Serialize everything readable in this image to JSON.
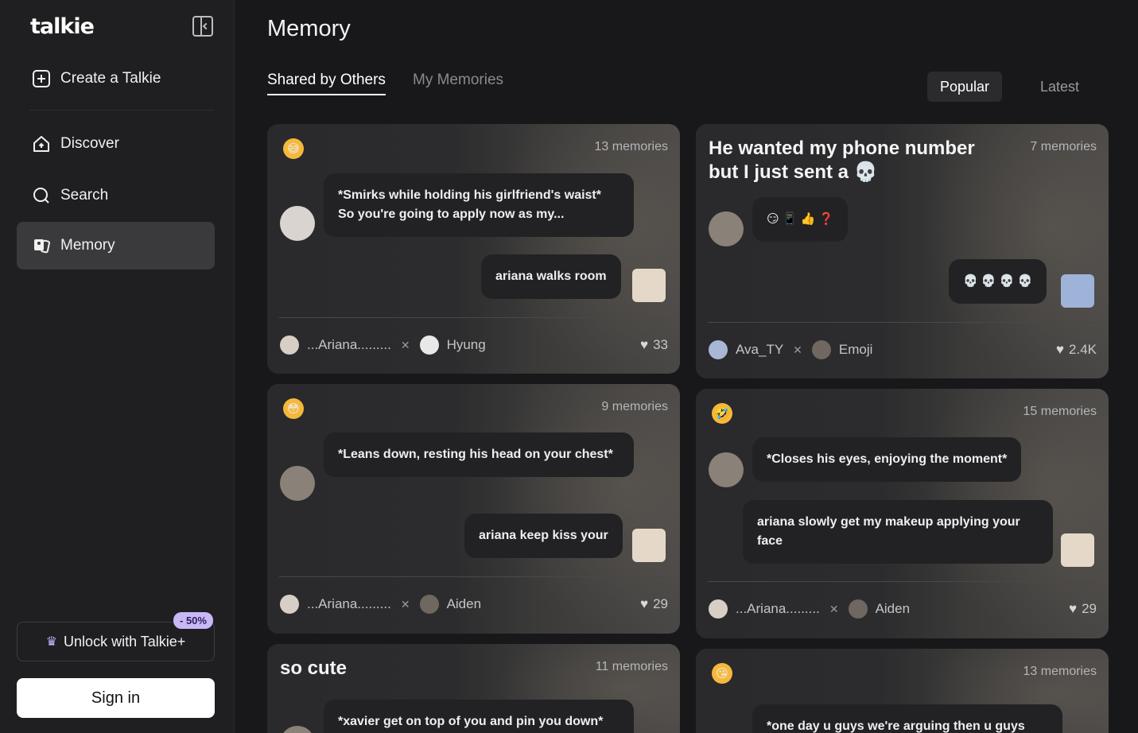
{
  "app": {
    "logo": "talkie"
  },
  "sidebar": {
    "create": "Create a Talkie",
    "items": [
      {
        "label": "Discover"
      },
      {
        "label": "Search"
      },
      {
        "label": "Memory"
      }
    ],
    "unlock": "Unlock with Talkie+",
    "discount": "- 50%",
    "signin": "Sign in"
  },
  "header": {
    "title": "Memory",
    "tabs": [
      "Shared by Others",
      "My Memories"
    ],
    "sort": [
      "Popular",
      "Latest"
    ]
  },
  "cards": [
    {
      "emoji": "😅",
      "count": "13 memories",
      "bubble1": "*Smirks while holding his girlfriend's waist* So you're going to apply now as my...",
      "bubble2": "ariana walks room",
      "user1": "...Ariana.........",
      "user2": "Hyung",
      "likes": "33"
    },
    {
      "title": "He wanted my phone number but I just sent a 💀",
      "count": "7 memories",
      "bubble1": "😏 📱 👍 ❓",
      "bubble2": "💀 💀 💀 💀",
      "user1": "Ava_TY",
      "user2": "Emoji",
      "likes": "2.4K"
    },
    {
      "emoji": "😳",
      "count": "9 memories",
      "bubble1": "*Leans down, resting his head on your chest*",
      "bubble2": "ariana keep kiss your",
      "user1": "...Ariana.........",
      "user2": "Aiden",
      "likes": "29"
    },
    {
      "emoji": "🤣",
      "count": "15 memories",
      "bubble1": "*Closes his eyes, enjoying the moment*",
      "bubble2": "ariana slowly get my makeup applying your face",
      "user1": "...Ariana.........",
      "user2": "Aiden",
      "likes": "29"
    },
    {
      "title": "so cute",
      "count": "11 memories",
      "bubble1": "*xavier get on top of you and pin you down* don't listen to ariana tell me I like it"
    },
    {
      "emoji": "😘",
      "count": "13 memories",
      "bubble1": "*one day u guys we're arguing then u guys"
    }
  ]
}
